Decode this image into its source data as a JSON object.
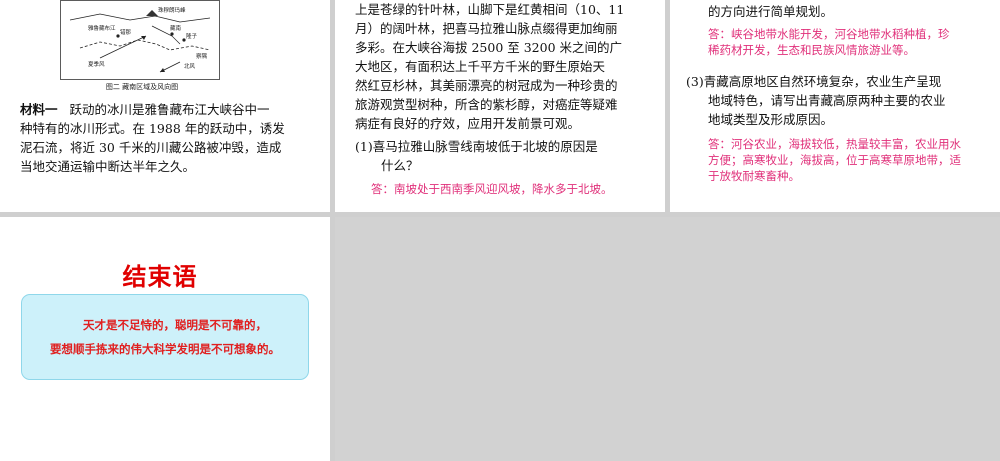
{
  "panel1": {
    "map_labels": [
      "珠穆朗玛峰",
      "藏南",
      "雅鲁藏布江",
      "错那",
      "隆子",
      "察隅",
      "夏季风",
      "北风"
    ],
    "map_caption": "图二 藏南区域及风向图",
    "material_label": "材料一",
    "material_text": [
      "跃动的冰川是雅鲁藏布江大峡谷中一",
      "种特有的冰川形式。在 1988 年的跃动中，诱发",
      "泥石流，将近 30 千米的川藏公路被冲毁，造成",
      "当地交通运输中断达半年之久。"
    ]
  },
  "panel2": {
    "text": [
      "上是苍绿的针叶林，山脚下是红黄相间（10、11",
      "月）的阔叶林，把喜马拉雅山脉点缀得更加绚丽",
      "多彩。在大峡谷海拔 2500 至 3200 米之间的广",
      "大地区，有面积达上千平方千米的野生原始天",
      "然红豆杉林，其美丽漂亮的树冠成为一种珍贵的",
      "旅游观赏型树种，所含的紫杉醇，对癌症等疑难",
      "病症有良好的疗效，应用开发前景可观。"
    ],
    "question1": [
      "(1)喜马拉雅山脉雪线南坡低于北坡的原因是",
      "什么？"
    ],
    "answer1": "答：南坡处于西南季风迎风坡，降水多于北坡。"
  },
  "panel3": {
    "top_line": "的方向进行简单规划。",
    "answer2": [
      "答：峡谷地带水能开发，河谷地带水稻种植，珍",
      "稀药材开发，生态和民族风情旅游业等。"
    ],
    "question3": [
      "(3)青藏高原地区自然环境复杂，农业生产呈现",
      "地域特色，请写出青藏高原两种主要的农业",
      "地域类型及形成原因。"
    ],
    "answer3": [
      "答：河谷农业，海拔较低，热量较丰富，农业用水",
      "方便；高寒牧业，海拔高，位于高寒草原地带，适",
      "于放牧耐寒畜种。"
    ]
  },
  "panel4": {
    "title": "结束语",
    "quote_line1": "天才是不足恃的，聪明是不可靠的，",
    "quote_line2": "要想顺手拣来的伟大科学发明是不可想象的。"
  },
  "colors": {
    "answer": "#e0307a",
    "title": "#e00000",
    "quote_box": "#cdf1fa",
    "background": "#cfcfcf"
  }
}
